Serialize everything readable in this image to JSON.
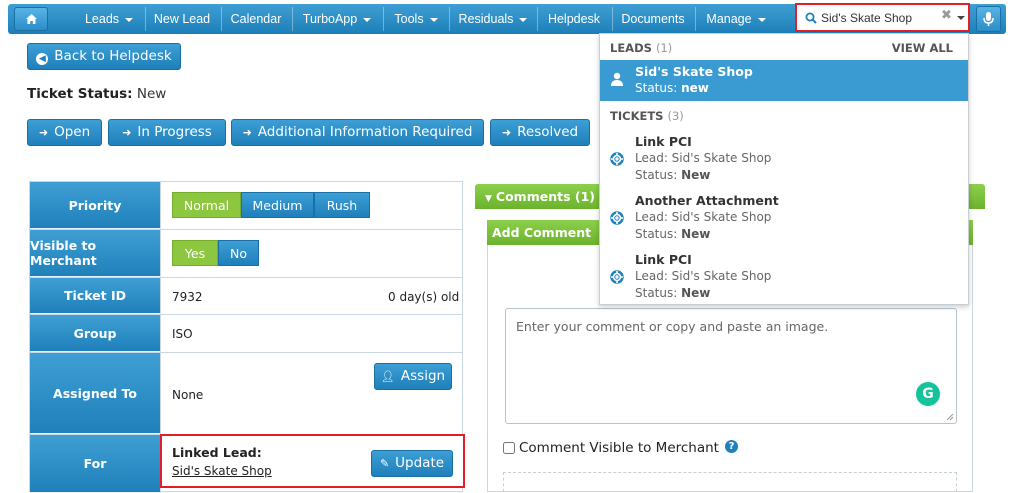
{
  "nav": {
    "items": [
      {
        "label": "Leads",
        "dropdown": true
      },
      {
        "label": "New Lead",
        "dropdown": false
      },
      {
        "label": "Calendar",
        "dropdown": false
      },
      {
        "label": "TurboApp",
        "dropdown": true
      },
      {
        "label": "Tools",
        "dropdown": true
      },
      {
        "label": "Residuals",
        "dropdown": true
      },
      {
        "label": "Helpdesk",
        "dropdown": false
      },
      {
        "label": "Documents",
        "dropdown": false
      },
      {
        "label": "Manage",
        "dropdown": true
      }
    ],
    "search_value": "Sid's Skate Shop"
  },
  "back_button": "Back to Helpdesk",
  "ticket_status": {
    "label": "Ticket Status:",
    "value": "New"
  },
  "status_buttons": [
    "Open",
    "In Progress",
    "Additional Information Required",
    "Resolved"
  ],
  "details": {
    "priority": {
      "label": "Priority",
      "options": [
        "Normal",
        "Medium",
        "Rush"
      ],
      "selected": "Normal"
    },
    "visible": {
      "label": "Visible to Merchant",
      "options": [
        "Yes",
        "No"
      ],
      "selected": "Yes"
    },
    "ticket_id": {
      "label": "Ticket ID",
      "value": "7932",
      "age": "0 day(s) old"
    },
    "group": {
      "label": "Group",
      "value": "ISO"
    },
    "assigned": {
      "label": "Assigned To",
      "value": "None",
      "button": "Assign"
    },
    "for": {
      "label": "For",
      "linked_label": "Linked Lead:",
      "linked_value": "Sid's Skate Shop",
      "button": "Update"
    }
  },
  "comments": {
    "header": "Comments (1)",
    "add_header": "Add Comment",
    "placeholder": "Enter your comment or copy and paste an image.",
    "visible_label": "Comment Visible to Merchant"
  },
  "dropdown": {
    "leads_title": "LEADS",
    "leads_count": "(1)",
    "view_all": "VIEW ALL",
    "lead": {
      "name": "Sid's Skate Shop",
      "status_label": "Status:",
      "status": "new"
    },
    "tickets_title": "TICKETS",
    "tickets_count": "(3)",
    "tickets": [
      {
        "title": "Link PCI",
        "lead": "Lead: Sid's Skate Shop",
        "status_label": "Status:",
        "status": "New"
      },
      {
        "title": "Another Attachment",
        "lead": "Lead: Sid's Skate Shop",
        "status_label": "Status:",
        "status": "New"
      },
      {
        "title": "Link PCI",
        "lead": "Lead: Sid's Skate Shop",
        "status_label": "Status:",
        "status": "New"
      }
    ]
  },
  "colors": {
    "accent_blue": "#1f80bb",
    "accent_green": "#8dc63f",
    "highlight_red": "#e41e26"
  }
}
